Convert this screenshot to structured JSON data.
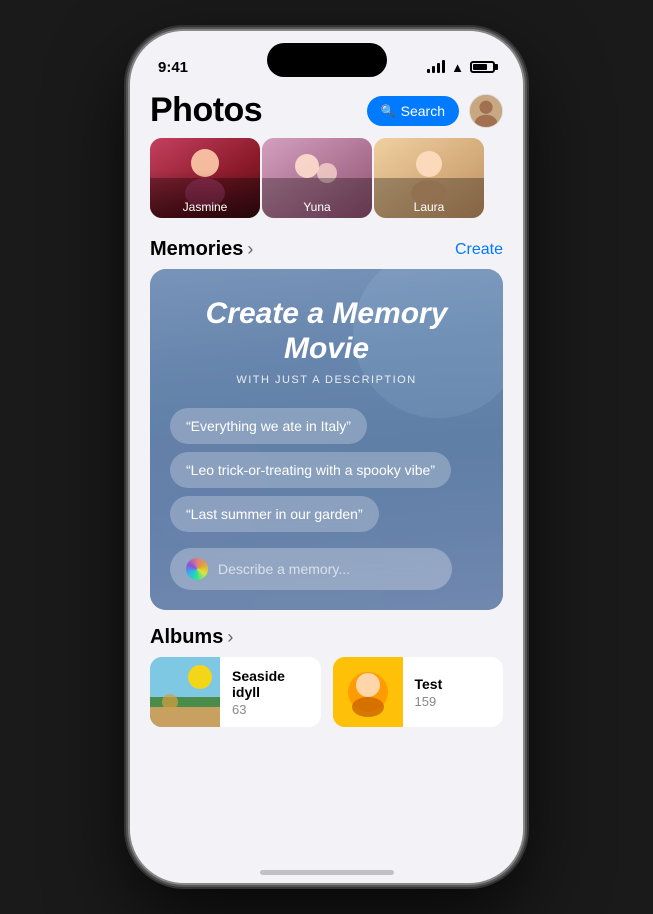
{
  "status_bar": {
    "time": "9:41"
  },
  "header": {
    "title": "Photos",
    "search_label": "Search",
    "search_icon": "magnifying-glass"
  },
  "people": [
    {
      "name": "Jasmine",
      "color_start": "#c44060",
      "color_end": "#8b1a2a"
    },
    {
      "name": "Yuna",
      "color_start": "#d4a0c0",
      "color_end": "#a07080"
    },
    {
      "name": "Laura",
      "color_start": "#f0d0a0",
      "color_end": "#b09060"
    }
  ],
  "memories": {
    "section_title": "Memories",
    "create_label": "Create",
    "card": {
      "title": "Create a Memory Movie",
      "subtitle": "WITH JUST A DESCRIPTION",
      "chips": [
        "“Everything we ate in Italy”",
        "“Leo trick-or-treating with a spooky vibe”",
        "“Last summer in our garden”"
      ],
      "input_placeholder": "Describe a memory..."
    }
  },
  "albums": {
    "section_title": "Albums",
    "items": [
      {
        "name": "Seaside idyll",
        "count": "63"
      },
      {
        "name": "Test",
        "count": "159"
      }
    ]
  }
}
